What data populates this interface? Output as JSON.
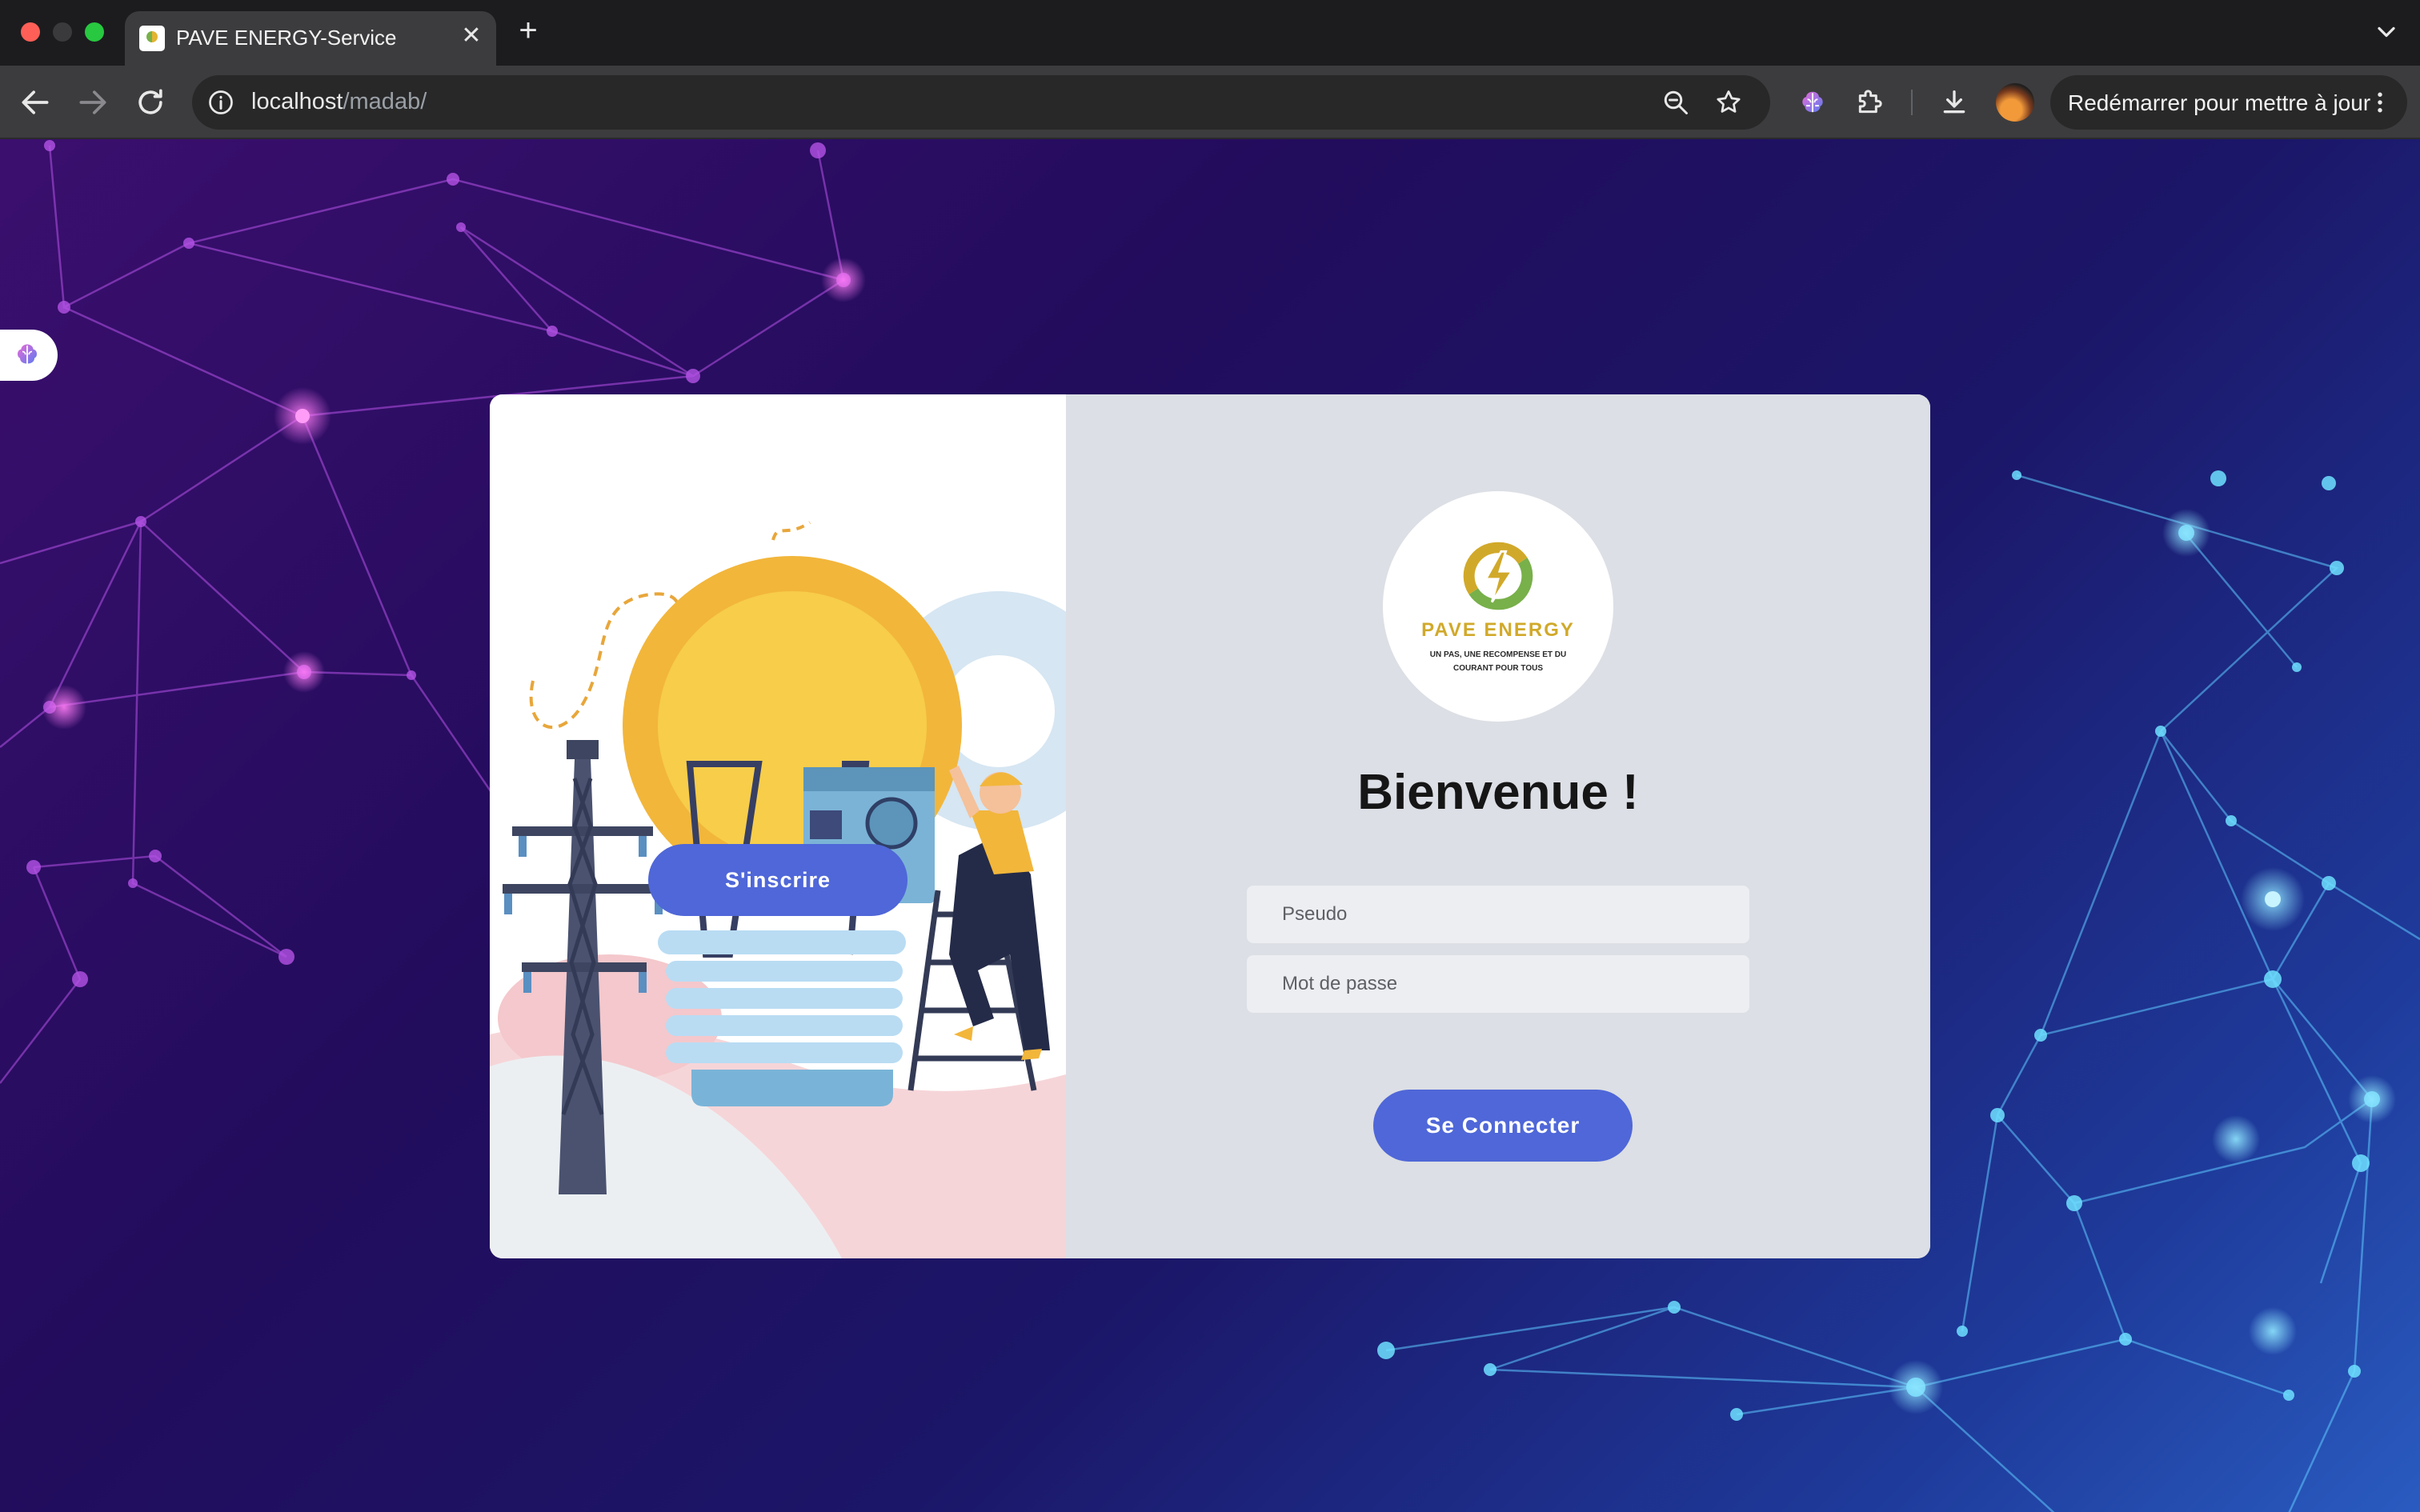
{
  "browser": {
    "tab_title": "PAVE ENERGY-Service",
    "tab_close": "✕",
    "new_tab": "+",
    "url_host": "localhost",
    "url_path": "/madab/",
    "update_label": "Redémarrer pour mettre à jour",
    "icons": [
      "back-icon",
      "forward-icon",
      "reload-icon",
      "site-info-icon",
      "zoom-out-icon",
      "bookmark-star-icon",
      "brain-extension-icon",
      "extensions-puzzle-icon",
      "download-icon",
      "more-vert-icon",
      "tab-list-chevron-icon"
    ]
  },
  "page": {
    "signup_label": "S'inscrire",
    "logo": {
      "name": "PAVE ENERGY",
      "tagline": "UN PAS, UNE RECOMPENSE ET DU COURANT POUR TOUS"
    },
    "welcome": "Bienvenue !",
    "form": {
      "username_placeholder": "Pseudo",
      "username_value": "",
      "password_placeholder": "Mot de passe",
      "password_value": ""
    },
    "login_label": "Se Connecter"
  },
  "colors": {
    "accent": "#4f67d8",
    "card_panel": "#dcdfe5",
    "logo_yellow": "#d1a92a",
    "logo_green": "#78b04a"
  }
}
